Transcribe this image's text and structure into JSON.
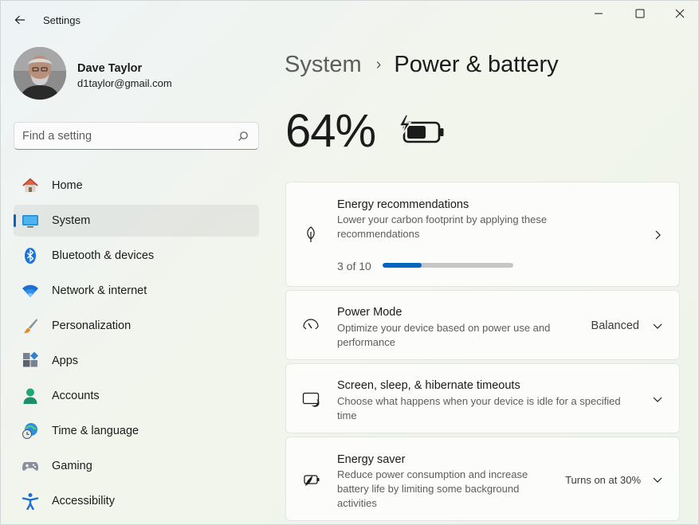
{
  "window": {
    "title": "Settings"
  },
  "profile": {
    "name": "Dave Taylor",
    "email": "d1taylor@gmail.com"
  },
  "search": {
    "placeholder": "Find a setting"
  },
  "nav": {
    "items": [
      {
        "label": "Home",
        "icon": "home-icon",
        "active": false
      },
      {
        "label": "System",
        "icon": "system-icon",
        "active": true
      },
      {
        "label": "Bluetooth & devices",
        "icon": "bluetooth-icon",
        "active": false
      },
      {
        "label": "Network & internet",
        "icon": "wifi-icon",
        "active": false
      },
      {
        "label": "Personalization",
        "icon": "brush-icon",
        "active": false
      },
      {
        "label": "Apps",
        "icon": "apps-icon",
        "active": false
      },
      {
        "label": "Accounts",
        "icon": "accounts-icon",
        "active": false
      },
      {
        "label": "Time & language",
        "icon": "globe-clock-icon",
        "active": false
      },
      {
        "label": "Gaming",
        "icon": "gamepad-icon",
        "active": false
      },
      {
        "label": "Accessibility",
        "icon": "accessibility-icon",
        "active": false
      }
    ]
  },
  "breadcrumb": {
    "parent": "System",
    "separator": "›",
    "current": "Power & battery"
  },
  "battery": {
    "percent": "64%",
    "level": 0.64,
    "charging": true
  },
  "cards": {
    "energy": {
      "title": "Energy recommendations",
      "desc_line1": "Lower your carbon footprint by applying these",
      "desc_line2": "recommendations",
      "progress_text": "3 of 10",
      "progress_done": 3,
      "progress_total": 10
    },
    "power_mode": {
      "title": "Power Mode",
      "desc_line1": "Optimize your device based on power use and",
      "desc_line2": "performance",
      "value": "Balanced"
    },
    "screen_sleep": {
      "title": "Screen, sleep, & hibernate timeouts",
      "desc_line1": "Choose what happens when your device is idle for a specified",
      "desc_line2": "time"
    },
    "energy_saver": {
      "title": "Energy saver",
      "desc_line1": "Reduce power consumption and increase",
      "desc_line2": "battery life by limiting some background",
      "desc_line3": "activities",
      "value": "Turns on at 30%"
    }
  },
  "colors": {
    "accent": "#0067c0",
    "active_nav_bg": "#ececec"
  }
}
